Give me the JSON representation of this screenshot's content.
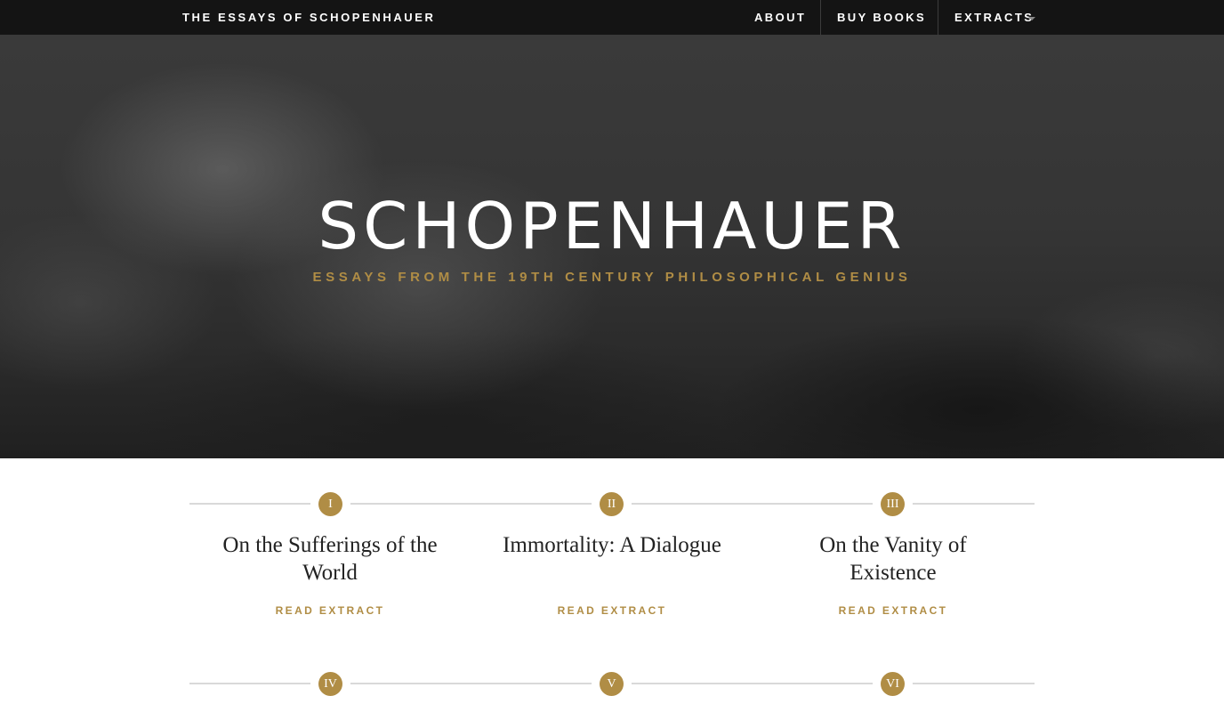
{
  "nav": {
    "brand": "THE ESSAYS OF SCHOPENHAUER",
    "items": [
      {
        "label": "ABOUT"
      },
      {
        "label": "BUY BOOKS"
      },
      {
        "label": "EXTRACTS",
        "has_dropdown": true
      }
    ]
  },
  "hero": {
    "title": "SCHOPENHAUER",
    "subtitle": "ESSAYS FROM THE 19TH CENTURY PHILOSOPHICAL GENIUS"
  },
  "essays": [
    {
      "numeral": "I",
      "title": "On the Sufferings of the World",
      "link": "READ EXTRACT"
    },
    {
      "numeral": "II",
      "title": "Immortality: A Dialogue",
      "link": "READ EXTRACT"
    },
    {
      "numeral": "III",
      "title": "On the Vanity of Existence",
      "link": "READ EXTRACT"
    },
    {
      "numeral": "IV"
    },
    {
      "numeral": "V"
    },
    {
      "numeral": "VI"
    }
  ],
  "colors": {
    "accent": "#b08d45",
    "navbar": "#141414",
    "hero_bg": "#333333",
    "title_text": "#222222"
  },
  "icons": {
    "extracts_dropdown": "caret-down-icon"
  }
}
